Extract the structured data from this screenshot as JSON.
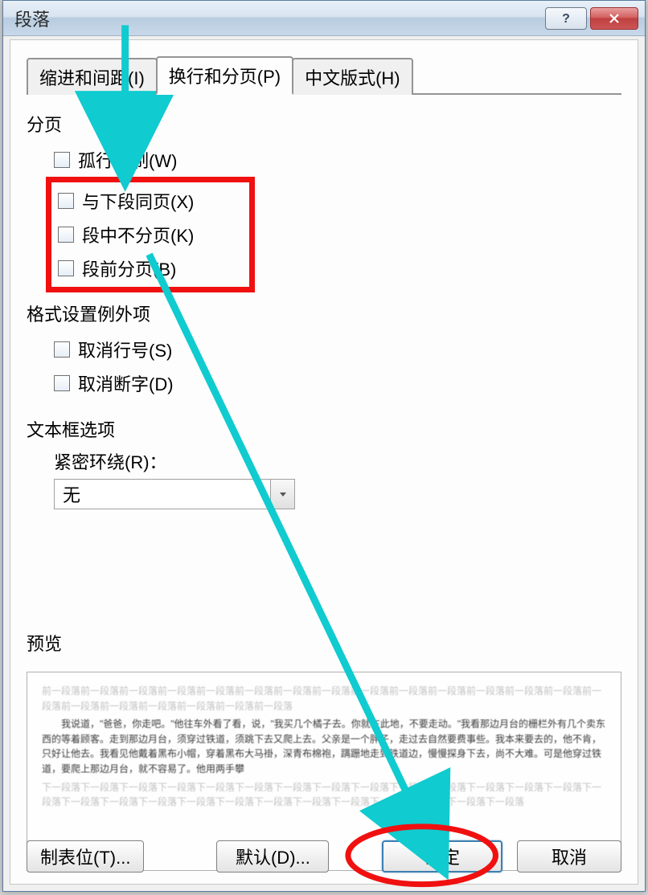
{
  "title": "段落",
  "tabs": {
    "indent": "缩进和间距(I)",
    "pagination": "换行和分页(P)",
    "asian": "中文版式(H)"
  },
  "sections": {
    "pagination": "分页",
    "exceptions": "格式设置例外项",
    "textbox": "文本框选项",
    "preview": "预览"
  },
  "checkboxes": {
    "widow": "孤行控制(W)",
    "keep_next": "与下段同页(X)",
    "keep_together": "段中不分页(K)",
    "page_break": "段前分页(B)",
    "suppress_line": "取消行号(S)",
    "suppress_hyphen": "取消断字(D)"
  },
  "textbox": {
    "tight_wrap_label": "紧密环绕(R)：",
    "tight_wrap_value": "无"
  },
  "preview_text": {
    "gray_top": "前一段落前一段落前一段落前一段落前一段落前一段落前一段落前一段落前一段落前一段落前一段落前一段落前一段落前一段落前一段落前一段落前一段落前一段落前一段落前一段落前一段落",
    "main": "我说道，\"爸爸，你走吧。\"他往车外看了看，说，\"我买几个橘子去。你就在此地，不要走动。\"我看那边月台的栅栏外有几个卖东西的等着顾客。走到那边月台，须穿过铁道，须跳下去又爬上去。父亲是一个胖子，走过去自然要费事些。我本来要去的，他不肯，只好让他去。我看见他戴着黑布小帽，穿着黑布大马褂，深青布棉袍，蹒跚地走到铁道边，慢慢探身下去，尚不大难。可是他穿过铁道，要爬上那边月台，就不容易了。他用两手攀",
    "gray_bottom": "下一段落下一段落下一段落下一段落下一段落下一段落下一段落下一段落下一段落下一段落下一段落下一段落下一段落下一段落下一段落下一段落下一段落下一段落下一段落下一段落下一段落下一段落下一段落下一段落下一段落下一段落下一段落"
  },
  "buttons": {
    "tabs": "制表位(T)...",
    "default": "默认(D)...",
    "ok": "确定",
    "cancel": "取消"
  },
  "annotation_colors": {
    "arrow": "#10cbcf",
    "highlight": "#f01010"
  }
}
